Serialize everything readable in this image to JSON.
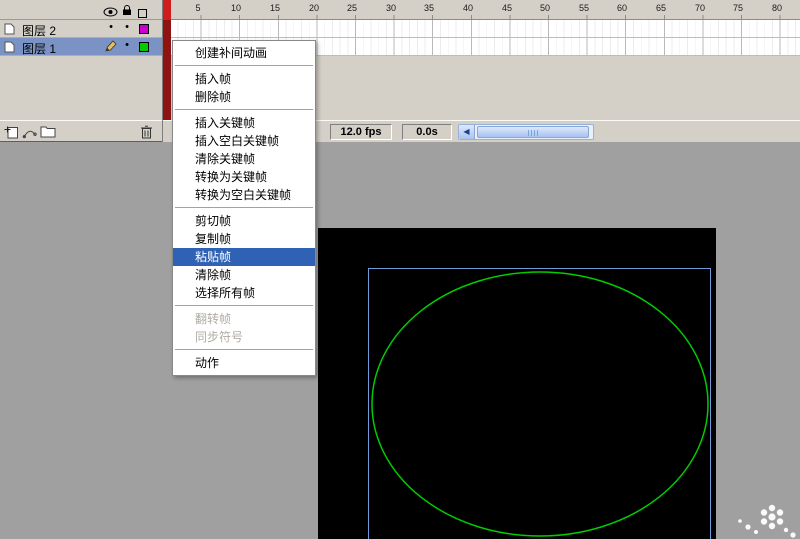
{
  "colors": {
    "panel_gray": "#d4d0c8",
    "selected_layer_row": "#7a93c4",
    "menu_highlight": "#2f62b5",
    "playhead_red": "#cf1d1d",
    "stage_black": "#000000",
    "selection_rect_blue": "#6f9bd8",
    "ellipse_green": "#00cc00",
    "layer2_outline_color": "#cc00cc",
    "layer1_outline_color": "#00cc00"
  },
  "layers_panel": {
    "header_icons": [
      "eye-icon",
      "lock-icon",
      "outline-icon"
    ],
    "layers": [
      {
        "label": "图层 2",
        "selected": false,
        "swatch": "#cc00cc",
        "dots": [
          "•",
          "•"
        ]
      },
      {
        "label": "图层 1",
        "selected": true,
        "swatch": "#00cc00",
        "active_pencil": true,
        "dots": [
          "•"
        ]
      }
    ],
    "toolbar_icons": [
      "insert-layer-icon",
      "add-motion-guide-icon",
      "insert-layer-folder-icon",
      "delete-layer-icon"
    ]
  },
  "timeline": {
    "ruler": [
      "5",
      "10",
      "15",
      "20",
      "25",
      "30",
      "35",
      "40",
      "45",
      "50",
      "55",
      "60",
      "65",
      "70",
      "75",
      "80"
    ]
  },
  "status_bar": {
    "fps": "12.0 fps",
    "elapsed": "0.0s",
    "scrollbar_arrow": "◀"
  },
  "context_menu": {
    "items": [
      {
        "label": "创建补间动画",
        "state": "normal"
      },
      {
        "label": "插入帧",
        "state": "normal"
      },
      {
        "label": "删除帧",
        "state": "normal"
      },
      {
        "label": "插入关键帧",
        "state": "normal"
      },
      {
        "label": "插入空白关键帧",
        "state": "normal"
      },
      {
        "label": "清除关键帧",
        "state": "normal"
      },
      {
        "label": "转换为关键帧",
        "state": "normal"
      },
      {
        "label": "转换为空白关键帧",
        "state": "normal"
      },
      {
        "label": "剪切帧",
        "state": "normal"
      },
      {
        "label": "复制帧",
        "state": "normal"
      },
      {
        "label": "粘贴帧",
        "state": "highlighted"
      },
      {
        "label": "清除帧",
        "state": "normal"
      },
      {
        "label": "选择所有帧",
        "state": "normal"
      },
      {
        "label": "翻转帧",
        "state": "disabled"
      },
      {
        "label": "同步符号",
        "state": "disabled"
      },
      {
        "label": "动作",
        "state": "normal"
      }
    ]
  }
}
